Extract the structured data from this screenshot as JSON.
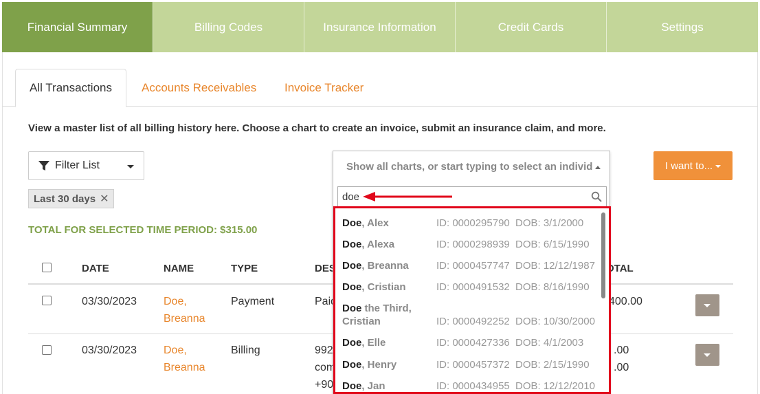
{
  "nav": {
    "tabs": [
      {
        "label": "Financial Summary"
      },
      {
        "label": "Billing Codes"
      },
      {
        "label": "Insurance Information"
      },
      {
        "label": "Credit Cards"
      },
      {
        "label": "Settings"
      }
    ]
  },
  "subtabs": {
    "all": "All Transactions",
    "ar": "Accounts Receivables",
    "invoice": "Invoice Tracker"
  },
  "intro": "View a master list of all billing history here. Choose a chart to create an invoice, submit an insurance claim, and more.",
  "filter": {
    "label": "Filter List"
  },
  "chip": {
    "label": "Last 30 days",
    "remove": "✕"
  },
  "total": "TOTAL FOR SELECTED TIME PERIOD: $315.00",
  "table": {
    "headers": {
      "date": "DATE",
      "name": "NAME",
      "type": "TYPE",
      "desc": "DES",
      "total": "OTAL"
    },
    "rows": [
      {
        "date": "03/30/2023",
        "name1": "Doe,",
        "name2": "Breanna",
        "type": "Payment",
        "desc1": "Paid",
        "total1": "400.00"
      },
      {
        "date": "03/30/2023",
        "name1": "Doe,",
        "name2": "Breanna",
        "type": "Billing",
        "desc1": "992",
        "desc2": "com",
        "desc3": "+90",
        "total1": ".00",
        "total2": ".00"
      }
    ]
  },
  "iwant": {
    "label": "I want to..."
  },
  "chartsel": {
    "placeholder": "Show all charts, or start typing to select an individ",
    "search_value": "doe"
  },
  "results": [
    {
      "bold": "Doe",
      "rest": ", Alex",
      "id": "ID: 0000295790",
      "dob": "DOB: 3/1/2000"
    },
    {
      "bold": "Doe",
      "rest": ", Alexa",
      "id": "ID: 0000298939",
      "dob": "DOB: 6/15/1990"
    },
    {
      "bold": "Doe",
      "rest": ", Breanna",
      "id": "ID: 0000457747",
      "dob": "DOB: 12/12/1987"
    },
    {
      "bold": "Doe",
      "rest": ", Cristian",
      "id": "ID: 0000491532",
      "dob": "DOB: 8/16/1990"
    },
    {
      "bold": "Doe",
      "rest": " the Third,",
      "rest2": "Cristian",
      "id": "ID: 0000492252",
      "dob": "DOB: 10/30/2000"
    },
    {
      "bold": "Doe",
      "rest": ", Elle",
      "id": "ID: 0000427336",
      "dob": "DOB: 4/1/2003"
    },
    {
      "bold": "Doe",
      "rest": ", Henry",
      "id": "ID: 0000457372",
      "dob": "DOB: 2/15/1990"
    },
    {
      "bold": "Doe",
      "rest": ", Jan",
      "id": "ID: 0000434955",
      "dob": "DOB: 12/12/2010"
    }
  ],
  "colors": {
    "nav_active": "#7fa14a",
    "nav_bg": "#c3d699",
    "accent_orange": "#f0913a",
    "highlight_red": "#e1071b"
  }
}
